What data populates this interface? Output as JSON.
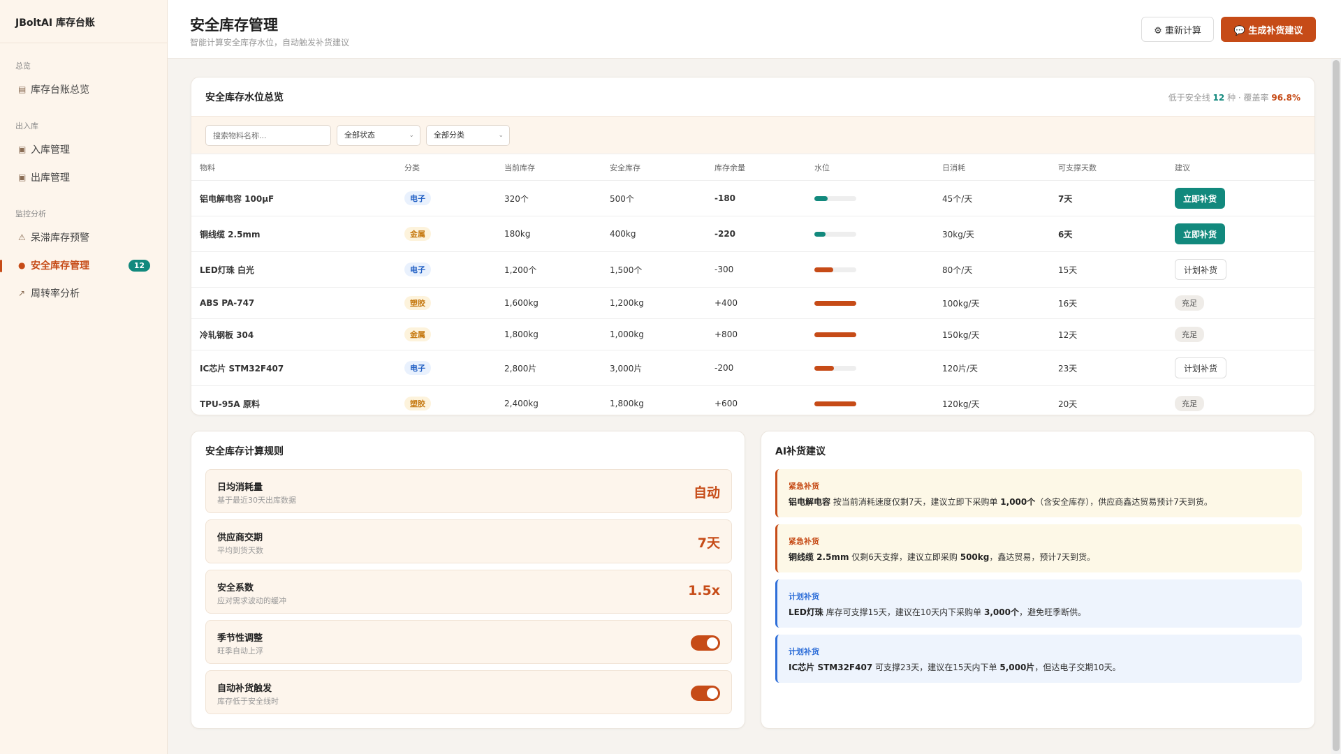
{
  "brand": "JBoltAI 库存台账",
  "nav": {
    "groups": [
      {
        "label": "总览"
      },
      {
        "label": "出入库"
      },
      {
        "label": "监控分析"
      }
    ],
    "items": [
      {
        "label": "库存台账总览"
      },
      {
        "label": "入库管理"
      },
      {
        "label": "出库管理"
      },
      {
        "label": "呆滞库存预警"
      },
      {
        "label": "安全库存管理",
        "badge": "12"
      },
      {
        "label": "周转率分析"
      }
    ]
  },
  "header": {
    "title": "安全库存管理",
    "subtitle": "智能计算安全库存水位，自动触发补货建议",
    "recalc_label": "⚙ 重新计算",
    "suggest_label": "💬 生成补货建议"
  },
  "overview": {
    "title": "安全库存水位总览",
    "summary_prefix": "低于安全线",
    "summary_count": "12",
    "summary_mid": "种 · 覆盖率",
    "summary_rate": "96.8%",
    "search_placeholder": "搜索物料名称...",
    "status_filter": "全部状态",
    "category_filter": "全部分类",
    "columns": [
      "物料",
      "分类",
      "当前库存",
      "安全库存",
      "库存余量",
      "水位",
      "日消耗",
      "可支撑天数",
      "建议"
    ],
    "rows": [
      {
        "name": "铝电解电容 100μF",
        "cat": "电子",
        "current": "320个",
        "safe": "500个",
        "margin": "-180",
        "level": 0.32,
        "daily": "45个/天",
        "days": "7天",
        "action": "立即补货"
      },
      {
        "name": "铜线缆 2.5mm",
        "cat": "金属",
        "current": "180kg",
        "safe": "400kg",
        "margin": "-220",
        "level": 0.27,
        "daily": "30kg/天",
        "days": "6天",
        "action": "立即补货"
      },
      {
        "name": "LED灯珠 白光",
        "cat": "电子",
        "current": "1,200个",
        "safe": "1,500个",
        "margin": "-300",
        "level": 0.45,
        "daily": "80个/天",
        "days": "15天",
        "action": "计划补货"
      },
      {
        "name": "ABS PA-747",
        "cat": "塑胶",
        "current": "1,600kg",
        "safe": "1,200kg",
        "margin": "+400",
        "level": 1.0,
        "daily": "100kg/天",
        "days": "16天",
        "action": "充足"
      },
      {
        "name": "冷轧钢板 304",
        "cat": "金属",
        "current": "1,800kg",
        "safe": "1,000kg",
        "margin": "+800",
        "level": 1.0,
        "daily": "150kg/天",
        "days": "12天",
        "action": "充足"
      },
      {
        "name": "IC芯片 STM32F407",
        "cat": "电子",
        "current": "2,800片",
        "safe": "3,000片",
        "margin": "-200",
        "level": 0.47,
        "daily": "120片/天",
        "days": "23天",
        "action": "计划补货"
      },
      {
        "name": "TPU-95A 原料",
        "cat": "塑胶",
        "current": "2,400kg",
        "safe": "1,800kg",
        "margin": "+600",
        "level": 1.0,
        "daily": "120kg/天",
        "days": "20天",
        "action": "充足"
      }
    ]
  },
  "rules": {
    "title": "安全库存计算规则",
    "items": [
      {
        "name": "日均消耗量",
        "desc": "基于最近30天出库数据",
        "value": "自动"
      },
      {
        "name": "供应商交期",
        "desc": "平均到货天数",
        "value": "7天"
      },
      {
        "name": "安全系数",
        "desc": "应对需求波动的缓冲",
        "value": "1.5x"
      },
      {
        "name": "季节性调整",
        "desc": "旺季自动上浮",
        "toggle": true
      },
      {
        "name": "自动补货触发",
        "desc": "库存低于安全线时",
        "toggle": true
      }
    ]
  },
  "ai": {
    "title": "AI补货建议",
    "items": [
      {
        "tag": "紧急补货",
        "bold": "铝电解电容",
        "text1": " 按当前消耗速度仅剩7天，建议立即下采购单 ",
        "qty": "1,000个",
        "text2": "（含安全库存），供应商鑫达贸易预计7天到货。"
      },
      {
        "tag": "紧急补货",
        "bold": "铜线缆 2.5mm",
        "text1": " 仅剩6天支撑，建议立即采购 ",
        "qty": "500kg",
        "text2": "，鑫达贸易，预计7天到货。"
      },
      {
        "tag": "计划补货",
        "bold": "LED灯珠",
        "text1": " 库存可支撑15天，建议在10天内下采购单 ",
        "qty": "3,000个",
        "text2": "，避免旺季断供。"
      },
      {
        "tag": "计划补货",
        "bold": "IC芯片 STM32F407",
        "text1": " 可支撑23天，建议在15天内下单 ",
        "qty": "5,000片",
        "text2": "，但达电子交期10天。"
      }
    ]
  },
  "colors": {
    "accent": "#c64b17",
    "teal": "#12897d",
    "blue": "#2e6ed8"
  }
}
